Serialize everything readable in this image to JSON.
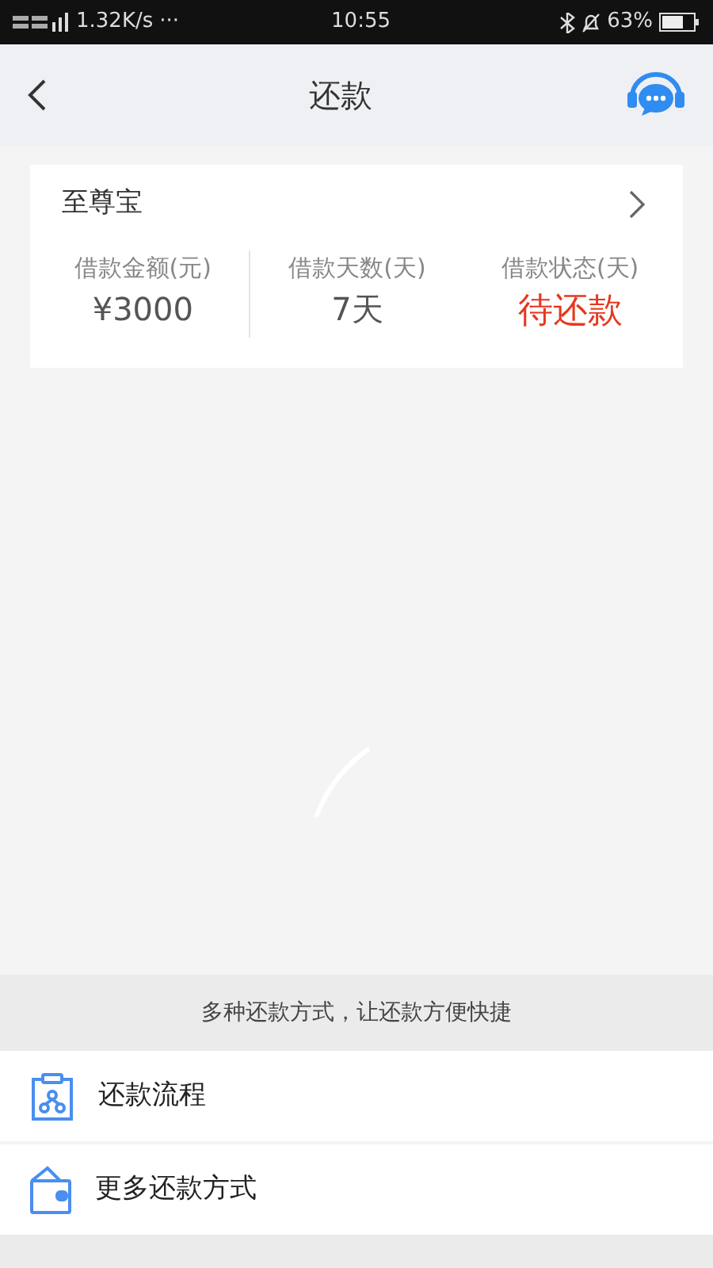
{
  "status_bar": {
    "speed": "1.32K/s",
    "dots": "···",
    "time": "10:55",
    "battery": "63%"
  },
  "header": {
    "title": "还款"
  },
  "loan_card": {
    "name": "至尊宝",
    "stats": [
      {
        "label": "借款金额(元)",
        "value": "¥3000",
        "kind": "normal"
      },
      {
        "label": "借款天数(天)",
        "value": "7天",
        "kind": "normal"
      },
      {
        "label": "借款状态(天)",
        "value": "待还款",
        "kind": "alert"
      }
    ]
  },
  "banner": "多种还款方式，让还款方便快捷",
  "menu": [
    {
      "label": "还款流程",
      "kind": "flow"
    },
    {
      "label": "更多还款方式",
      "kind": "wallet"
    }
  ]
}
